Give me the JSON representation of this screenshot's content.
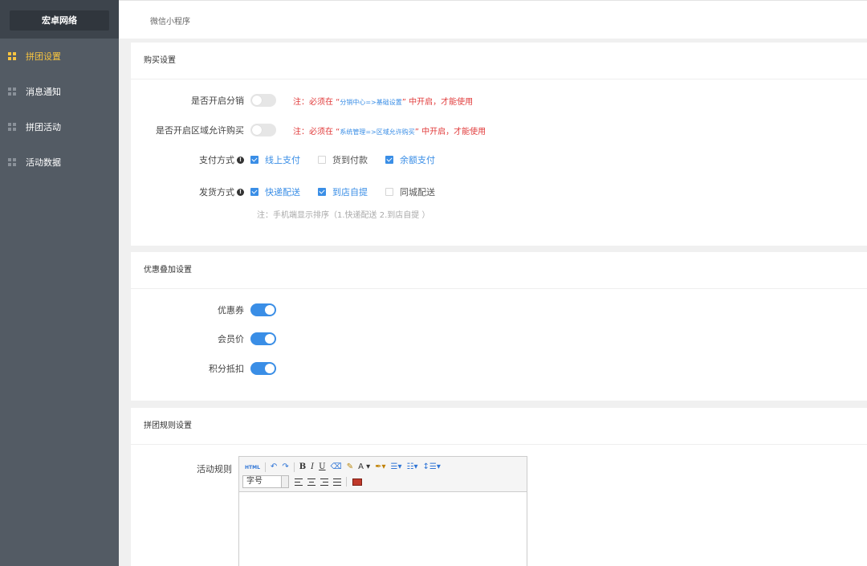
{
  "sidebar": {
    "brand": "宏卓网络",
    "items": [
      {
        "label": "拼团设置",
        "active": true
      },
      {
        "label": "消息通知",
        "active": false
      },
      {
        "label": "拼团活动",
        "active": false
      },
      {
        "label": "活动数据",
        "active": false
      }
    ]
  },
  "topbar": {
    "title": "微信小程序"
  },
  "purchase": {
    "title": "购买设置",
    "distribution": {
      "label": "是否开启分销",
      "enabled": false,
      "note_prefix": "注：必须在 “",
      "note_path": "分销中心=>基础设置",
      "note_suffix": "” 中开启，才能使用"
    },
    "region": {
      "label": "是否开启区域允许购买",
      "enabled": false,
      "note_prefix": "注：必须在 “",
      "note_path": "系统管理=>区域允许购买",
      "note_suffix": "” 中开启，才能使用"
    },
    "payment": {
      "label": "支付方式",
      "options": [
        {
          "label": "线上支付",
          "checked": true
        },
        {
          "label": "货到付款",
          "checked": false
        },
        {
          "label": "余额支付",
          "checked": true
        }
      ]
    },
    "shipping": {
      "label": "发货方式",
      "options": [
        {
          "label": "快递配送",
          "checked": true
        },
        {
          "label": "到店自提",
          "checked": true
        },
        {
          "label": "同城配送",
          "checked": false
        }
      ],
      "hint": "注：手机端显示排序（1.快递配送 2.到店自提 ）"
    }
  },
  "stacking": {
    "title": "优惠叠加设置",
    "items": [
      {
        "label": "优惠券",
        "enabled": true
      },
      {
        "label": "会员价",
        "enabled": true
      },
      {
        "label": "积分抵扣",
        "enabled": true
      }
    ]
  },
  "rules": {
    "title": "拼团规则设置",
    "label": "活动规则",
    "editor": {
      "html_btn": "HTML",
      "font_size_placeholder": "字号",
      "text_color_btn": "A"
    }
  },
  "colors": {
    "accent": "#3a8ee6",
    "warning": "#e13c3c",
    "active_nav": "#f7c440",
    "sidebar_bg": "#535b64"
  }
}
